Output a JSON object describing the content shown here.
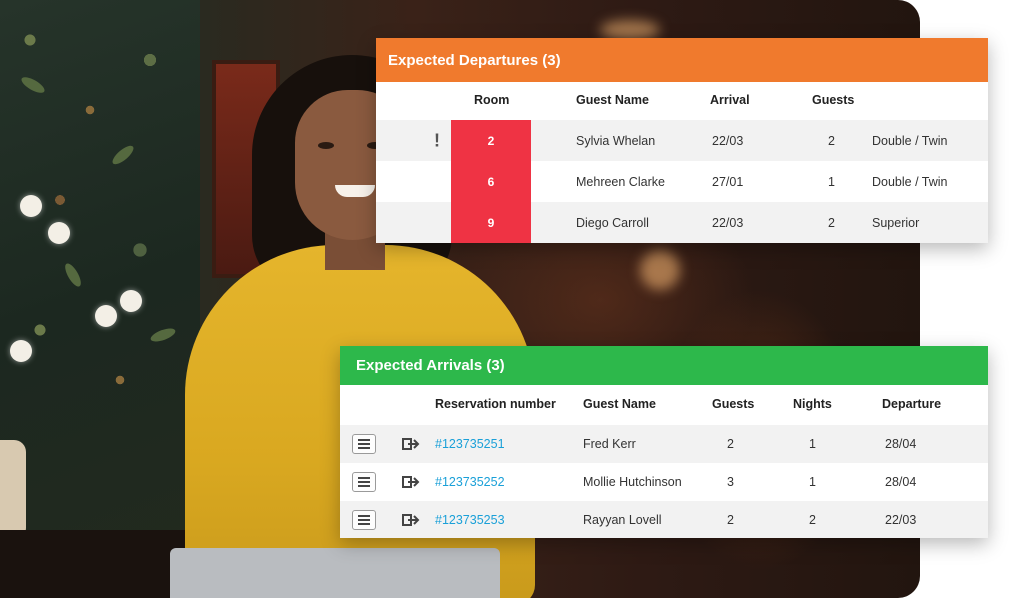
{
  "departures": {
    "title": "Expected Departures (3)",
    "header_color": "#f07a2d",
    "badge_color": "#ef3344",
    "columns": [
      "Room",
      "Guest Name",
      "Arrival",
      "Guests"
    ],
    "alert_icon": "exclamation-icon",
    "rows": [
      {
        "room": "2",
        "guest": "Sylvia Whelan",
        "arrival": "22/03",
        "guests": "2",
        "room_type": "Double / Twin"
      },
      {
        "room": "6",
        "guest": "Mehreen Clarke",
        "arrival": "27/01",
        "guests": "1",
        "room_type": "Double / Twin"
      },
      {
        "room": "9",
        "guest": "Diego Carroll",
        "arrival": "22/03",
        "guests": "2",
        "room_type": "Superior"
      }
    ]
  },
  "arrivals": {
    "title": "Expected Arrivals (3)",
    "header_color": "#2db84b",
    "link_color": "#1aa0d8",
    "columns": [
      "Reservation number",
      "Guest Name",
      "Guests",
      "Nights",
      "Departure"
    ],
    "row_icons": [
      "menu-icon",
      "check-in-icon"
    ],
    "rows": [
      {
        "reservation": "#123735251",
        "guest": "Fred Kerr",
        "guests": "2",
        "nights": "1",
        "departure": "28/04"
      },
      {
        "reservation": "#123735252",
        "guest": "Mollie Hutchinson",
        "guests": "3",
        "nights": "1",
        "departure": "28/04"
      },
      {
        "reservation": "#123735253",
        "guest": "Rayyan Lovell",
        "guests": "2",
        "nights": "2",
        "departure": "22/03"
      }
    ]
  }
}
